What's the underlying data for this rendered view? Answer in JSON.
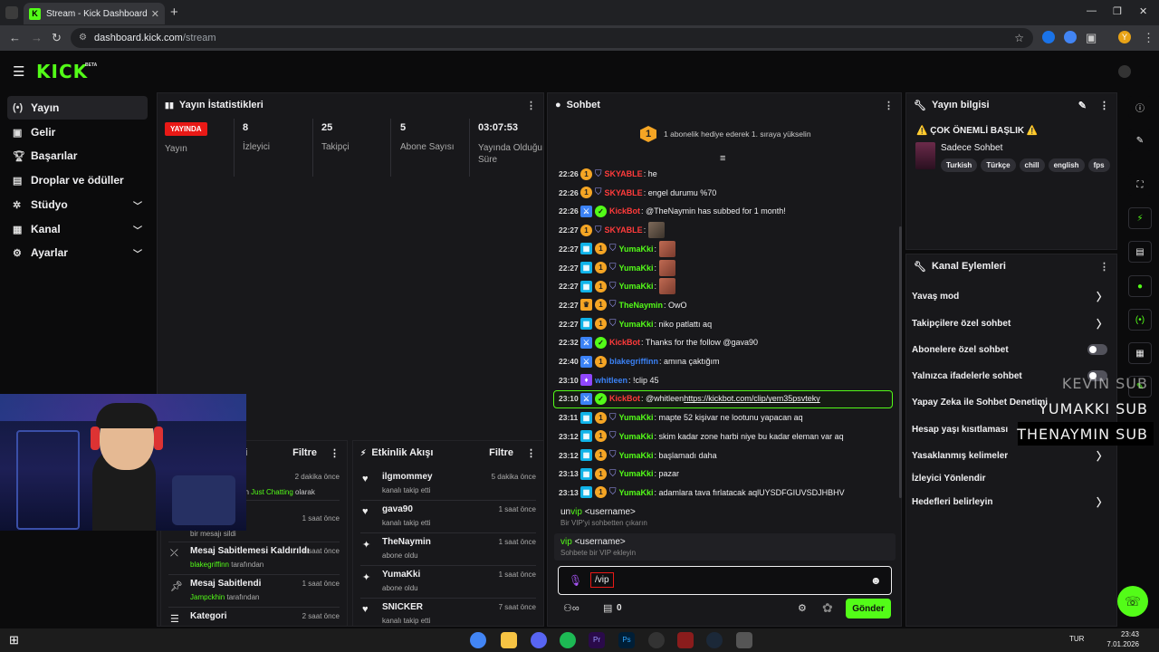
{
  "browser": {
    "tab_title": "Stream - Kick Dashboard",
    "url_host": "dashboard.kick.com",
    "url_path": "/stream",
    "profile_initial": "Y"
  },
  "header": {
    "logo": "KICK",
    "beta": "BETA"
  },
  "sidebar": {
    "items": [
      {
        "label": "Yayın",
        "icon": "broadcast-icon",
        "active": true
      },
      {
        "label": "Gelir",
        "icon": "revenue-icon"
      },
      {
        "label": "Başarılar",
        "icon": "trophy-icon"
      },
      {
        "label": "Droplar ve ödüller",
        "icon": "gift-icon"
      },
      {
        "label": "Stüdyo",
        "icon": "studio-icon",
        "expandable": true
      },
      {
        "label": "Kanal",
        "icon": "channel-icon",
        "expandable": true
      },
      {
        "label": "Ayarlar",
        "icon": "gear-icon",
        "expandable": true
      }
    ]
  },
  "stats": {
    "title": "Yayın İstatistikleri",
    "live_badge": "YAYINDA",
    "live_label": "Yayın",
    "viewers_value": "8",
    "viewers_label": "İzleyici",
    "followers_value": "25",
    "followers_label": "Takipçi",
    "subs_value": "5",
    "subs_label": "Abone Sayısı",
    "uptime_value": "03:07:53",
    "uptime_label": "Yayında Olduğu Süre"
  },
  "modlog": {
    "title_fragment": "ri",
    "filter": "Filtre",
    "rows": [
      {
        "name": "",
        "sub_a": "an ",
        "sub_b": "Just Chatting",
        "sub_c": " olarak",
        "time": "2 dakika önce"
      },
      {
        "name": "",
        "sub": "bir mesajı sildi",
        "time": "1 saat önce"
      },
      {
        "name": "Mesaj Sabitlemesi Kaldırıldı",
        "user": "blakegriffinn",
        "sub": " tarafından",
        "time": "1 saat önce"
      },
      {
        "name": "Mesaj Sabitlendi",
        "user": "Jampckhin",
        "sub": " tarafından",
        "time": "1 saat önce"
      },
      {
        "name": "Kategori",
        "time": "2 saat önce"
      }
    ]
  },
  "activity": {
    "title": "Etkinlik Akışı",
    "filter": "Filtre",
    "rows": [
      {
        "name": "ilgmommey",
        "sub": "kanalı takip etti",
        "time": "5 dakika önce"
      },
      {
        "name": "gava90",
        "sub": "kanalı takip etti",
        "time": "1 saat önce"
      },
      {
        "name": "TheNaymin",
        "sub": "abone oldu",
        "time": "1 saat önce"
      },
      {
        "name": "YumaKki",
        "sub": "abone oldu",
        "time": "1 saat önce"
      },
      {
        "name": "SNICKER",
        "sub": "kanalı takip etti",
        "time": "7 saat önce"
      }
    ]
  },
  "chat": {
    "title": "Sohbet",
    "gift_badge": "1",
    "gift_text": "1 abonelik hediye ederek 1. sıraya yükselin",
    "messages": [
      {
        "time": "22:26",
        "user": "SKYABLE",
        "text": ": he"
      },
      {
        "time": "22:26",
        "user": "SKYABLE",
        "text": ": engel durumu %70"
      },
      {
        "time": "22:26",
        "user": "KickBot",
        "text": ": @TheNaymin has subbed for 1 month!"
      },
      {
        "time": "22:27",
        "user": "SKYABLE",
        "text": ":"
      },
      {
        "time": "22:27",
        "user": "YumaKki",
        "text": ":"
      },
      {
        "time": "22:27",
        "user": "YumaKki",
        "text": ":"
      },
      {
        "time": "22:27",
        "user": "YumaKki",
        "text": ":"
      },
      {
        "time": "22:27",
        "user": "TheNaymin",
        "text": ": OwO"
      },
      {
        "time": "22:27",
        "user": "YumaKki",
        "text": ": niko patlattı aq"
      },
      {
        "time": "22:32",
        "user": "KickBot",
        "text": ": Thanks for the follow @gava90"
      },
      {
        "time": "22:40",
        "user": "blakegriffinn",
        "text": ": amına çaktığım"
      },
      {
        "time": "23:10",
        "user": "whitleen",
        "text": ": !clip 45"
      },
      {
        "time": "23:10",
        "user": "KickBot",
        "text": ": @whitleen ",
        "link": "https://kickbot.com/clip/yem35psvteky"
      },
      {
        "time": "23:11",
        "user": "YumaKki",
        "text": ": mapte 52 kişivar ne lootunu yapacan aq"
      },
      {
        "time": "23:12",
        "user": "YumaKki",
        "text": ": skim kadar zone harbi niye bu kadar eleman var aq"
      },
      {
        "time": "23:12",
        "user": "YumaKki",
        "text": ": başlamadı daha"
      },
      {
        "time": "23:13",
        "user": "YumaKki",
        "text": ": pazar"
      },
      {
        "time": "23:13",
        "user": "YumaKki",
        "text": ": adamlara tava fırlatacak aqlUYSDFGIUVSDJHBHV"
      }
    ],
    "suggestions": [
      {
        "cmd_a": "un",
        "cmd_b": "vip",
        "arg": " <username>",
        "desc": "Bir VIP'yi sohbetten çıkarın"
      },
      {
        "cmd_a": "",
        "cmd_b": "vip",
        "arg": " <username>",
        "desc": "Sohbete bir VIP ekleyin"
      }
    ],
    "input_value": "/vip",
    "points": "0",
    "send": "Gönder"
  },
  "stream_info": {
    "title": "Yayın bilgisi",
    "headline": "⚠️ ÇOK ÖNEMLİ BAŞLIK ⚠️",
    "category": "Sadece Sohbet",
    "tags": [
      "Turkish",
      "Türkçe",
      "chill",
      "english",
      "fps"
    ]
  },
  "channel_actions": {
    "title": "Kanal Eylemleri",
    "items": [
      {
        "label": "Yavaş mod",
        "control": "chevron"
      },
      {
        "label": "Takipçilere özel sohbet",
        "control": "chevron"
      },
      {
        "label": "Abonelere özel sohbet",
        "control": "toggle"
      },
      {
        "label": "Yalnızca ifadelerle sohbet",
        "control": "toggle"
      },
      {
        "label": "Yapay Zeka ile Sohbet Denetimi",
        "control": "none"
      },
      {
        "label": "Hesap yaşı kısıtlaması",
        "control": "none"
      },
      {
        "label": "Yasaklanmış kelimeler",
        "control": "chevron"
      },
      {
        "label": "İzleyici Yönlendir",
        "control": "none"
      },
      {
        "label": "Hedefleri belirleyin",
        "control": "chevron"
      }
    ]
  },
  "overlay": {
    "lines": [
      "KEVIN   SUB",
      "YUMAKKI  SUB",
      "THENAYMIN  SUB"
    ]
  },
  "taskbar": {
    "lang": "TUR",
    "time": "23:43",
    "date": "7.01.2026"
  }
}
